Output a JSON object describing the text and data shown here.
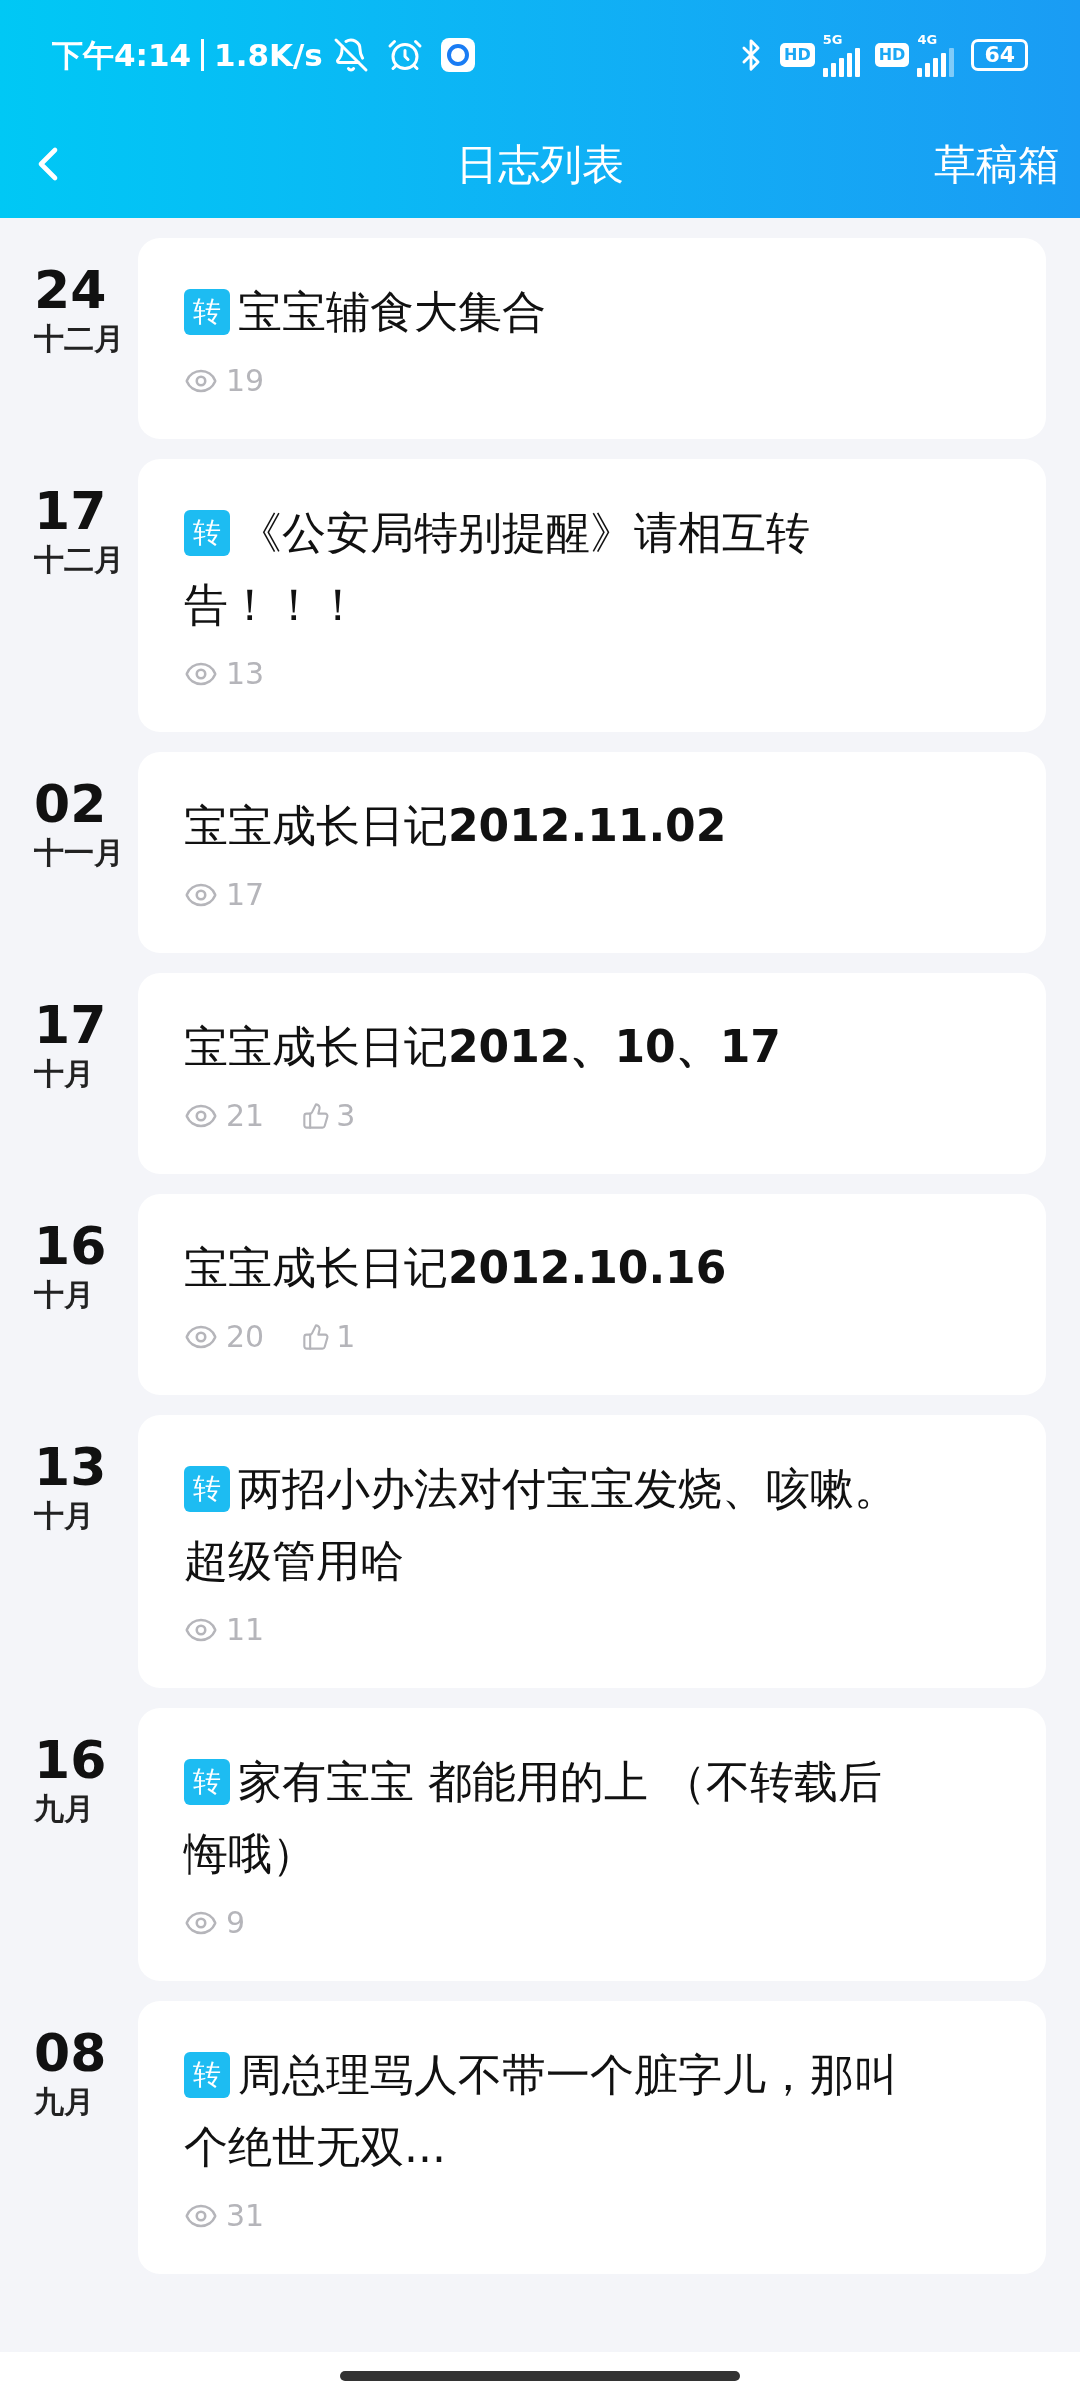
{
  "status_bar": {
    "time": "下午4:14",
    "speed": "1.8K/s",
    "hd_1": "HD",
    "net_1": "5G",
    "hd_2": "HD",
    "net_2": "4G",
    "battery": "64"
  },
  "nav": {
    "title": "日志列表",
    "action": "草稿箱"
  },
  "entries": [
    {
      "day": "24",
      "month": "十二月",
      "tag": "转",
      "title_lines": [
        "宝宝辅食大集合"
      ],
      "views": "19"
    },
    {
      "day": "17",
      "month": "十二月",
      "tag": "转",
      "title_lines": [
        "《公安局特别提醒》请相互转",
        "告！！！"
      ],
      "views": "13"
    },
    {
      "day": "02",
      "month": "十一月",
      "title_lines": [
        "宝宝成长日记**2012.11.02**"
      ],
      "views": "17"
    },
    {
      "day": "17",
      "month": "十月",
      "title_lines": [
        "宝宝成长日记**2012、10、17**"
      ],
      "views": "21",
      "likes": "3"
    },
    {
      "day": "16",
      "month": "十月",
      "title_lines": [
        "宝宝成长日记**2012.10.16**"
      ],
      "views": "20",
      "likes": "1"
    },
    {
      "day": "13",
      "month": "十月",
      "tag": "转",
      "title_lines": [
        "两招小办法对付宝宝发烧、咳嗽。",
        "超级管用哈"
      ],
      "views": "11"
    },
    {
      "day": "16",
      "month": "九月",
      "tag": "转",
      "title_lines": [
        "家有宝宝 都能用的上 （不转载后",
        "悔哦）"
      ],
      "views": "9"
    },
    {
      "day": "08",
      "month": "九月",
      "tag": "转",
      "title_lines": [
        "周总理骂人不带一个脏字儿，那叫",
        "个绝世无双..."
      ],
      "views": "31"
    }
  ]
}
